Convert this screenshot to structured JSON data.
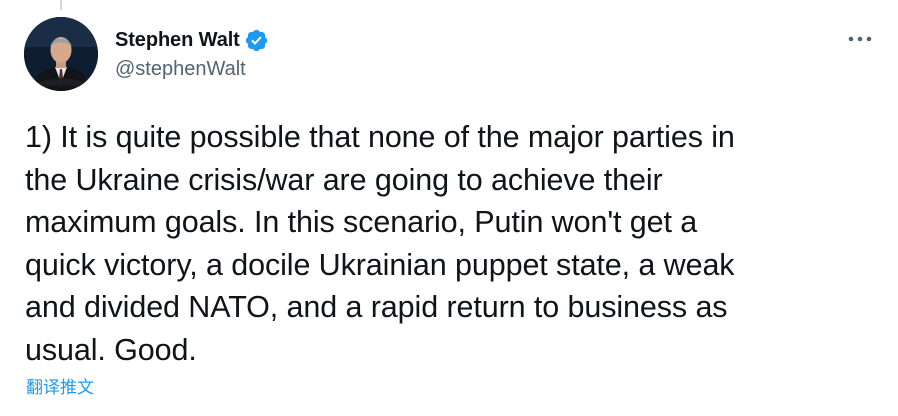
{
  "tweet": {
    "author": {
      "display_name": "Stephen Walt",
      "handle": "@stephenWalt",
      "verified": true,
      "avatar_icon": "profile-photo",
      "verified_icon": "verified-badge-icon"
    },
    "text": "1) It is quite possible that none of the major parties in\nthe Ukraine crisis/war are going to achieve their\nmaximum goals. In this scenario, Putin won't get a\nquick victory, a docile Ukrainian puppet state, a weak\nand divided NATO, and a rapid return to business as\nusual. Good.",
    "translate_label": "翻译推文",
    "more_icon": "more-options-icon"
  },
  "colors": {
    "text_primary": "#0f1419",
    "text_secondary": "#536471",
    "accent_blue": "#1d9bf0",
    "background": "#ffffff"
  }
}
